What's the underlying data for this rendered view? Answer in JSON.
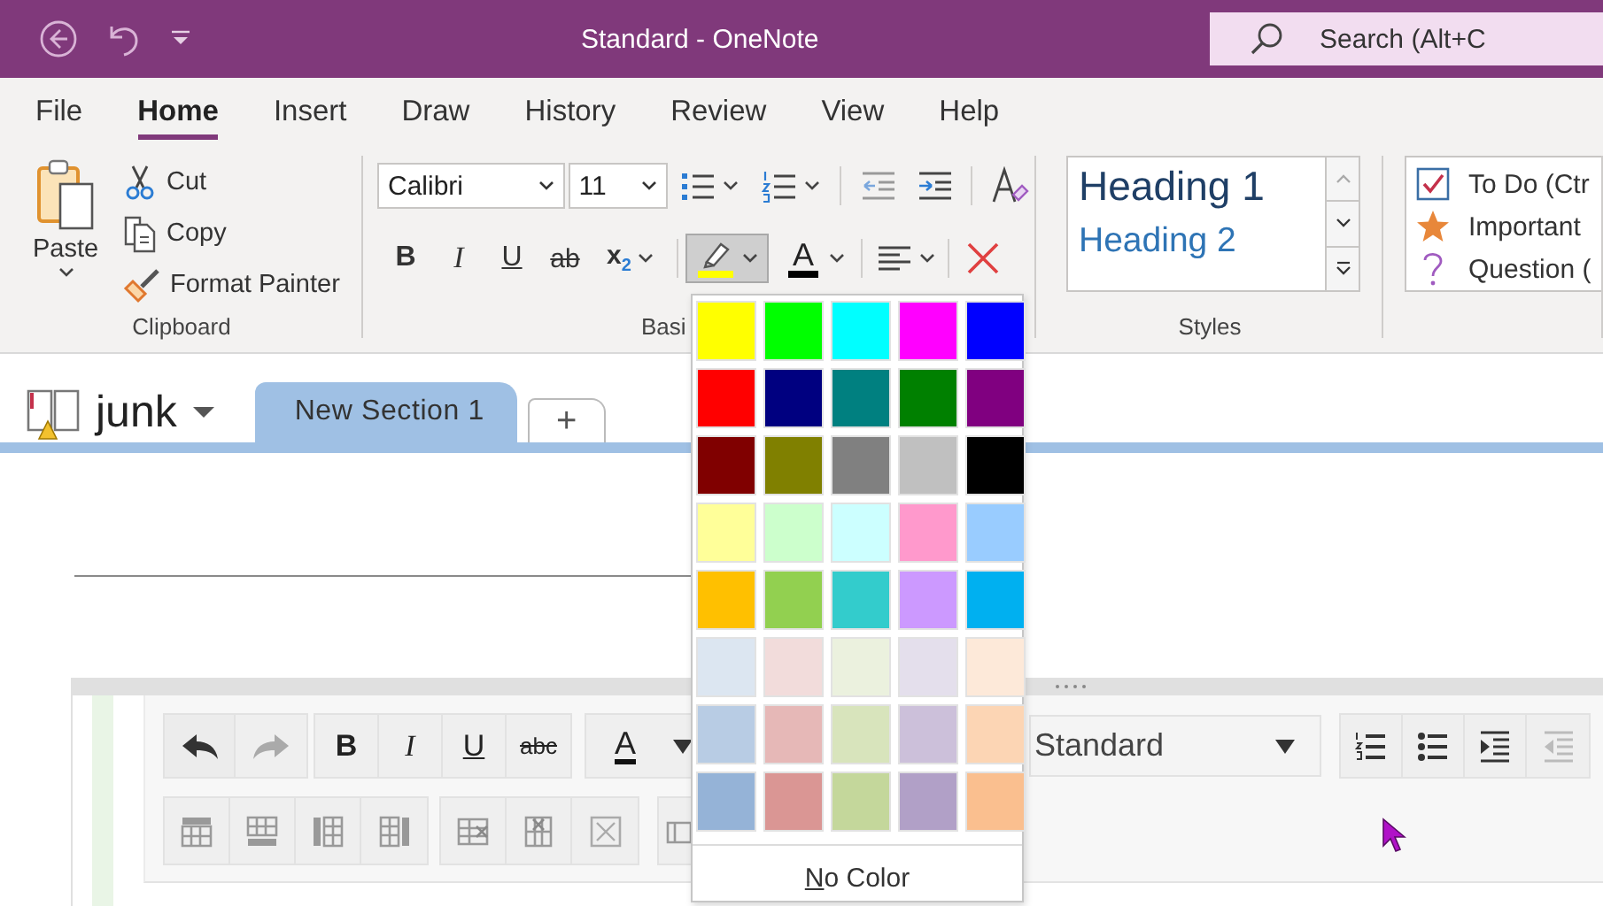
{
  "window": {
    "title": "Standard - OneNote"
  },
  "search": {
    "placeholder": "Search (Alt+C"
  },
  "menu_tabs": [
    {
      "label": "File",
      "selected": false
    },
    {
      "label": "Home",
      "selected": true
    },
    {
      "label": "Insert",
      "selected": false
    },
    {
      "label": "Draw",
      "selected": false
    },
    {
      "label": "History",
      "selected": false
    },
    {
      "label": "Review",
      "selected": false
    },
    {
      "label": "View",
      "selected": false
    },
    {
      "label": "Help",
      "selected": false
    }
  ],
  "clipboard": {
    "paste": "Paste",
    "cut": "Cut",
    "copy": "Copy",
    "format_painter": "Format Painter",
    "label": "Clipboard"
  },
  "basic_text": {
    "font": "Calibri",
    "size": "11",
    "bold": "B",
    "italic": "I",
    "underline": "U",
    "strikethrough": "ab",
    "subscript": "x$_{2}$",
    "font_color": "A",
    "label": "Basi"
  },
  "styles": {
    "items": [
      "Heading 1",
      "Heading 2"
    ],
    "label": "Styles"
  },
  "tags": [
    {
      "kind": "checkbox",
      "label": "To Do (Ctr"
    },
    {
      "kind": "star",
      "label": "Important"
    },
    {
      "kind": "question",
      "label": "Question ("
    }
  ],
  "notebook": {
    "name": "junk",
    "sections": [
      {
        "label": "New Section 1",
        "selected": true
      }
    ],
    "add_section": "+"
  },
  "editor": {
    "bold": "B",
    "italic": "I",
    "underline": "U",
    "strikethrough": "abc",
    "font_color": "A",
    "style_select": "Standard"
  },
  "highlight_menu": {
    "swatches": [
      {
        "color": "#ffff00"
      },
      {
        "color": "#00ff00"
      },
      {
        "color": "#00ffff"
      },
      {
        "color": "#ff00ff"
      },
      {
        "color": "#0000ff"
      },
      {
        "color": "#ff0000"
      },
      {
        "color": "#000080"
      },
      {
        "color": "#008080"
      },
      {
        "color": "#008000"
      },
      {
        "color": "#800080"
      },
      {
        "color": "#800000"
      },
      {
        "color": "#808000"
      },
      {
        "color": "#808080"
      },
      {
        "color": "#c0c0c0"
      },
      {
        "color": "#000000"
      },
      {
        "color": "#ffff99"
      },
      {
        "color": "#ccffcc"
      },
      {
        "color": "#ccffff"
      },
      {
        "color": "#ff99cc"
      },
      {
        "color": "#99ccff"
      },
      {
        "color": "#ffc000"
      },
      {
        "color": "#92d050"
      },
      {
        "color": "#33cccc"
      },
      {
        "color": "#cc99ff"
      },
      {
        "color": "#00b0f0"
      },
      {
        "color": "#dce6f1"
      },
      {
        "color": "#f2dcdb"
      },
      {
        "color": "#ebf1de"
      },
      {
        "color": "#e4dfec"
      },
      {
        "color": "#fde9d9"
      },
      {
        "color": "#b8cce4"
      },
      {
        "color": "#e6b8b7"
      },
      {
        "color": "#d8e4bc"
      },
      {
        "color": "#ccc0da"
      },
      {
        "color": "#fcd5b4"
      },
      {
        "color": "#95b3d7"
      },
      {
        "color": "#da9694"
      },
      {
        "color": "#c4d79b"
      },
      {
        "color": "#b1a0c7"
      },
      {
        "color": "#fabf8f"
      }
    ],
    "no_color": "No Color"
  }
}
